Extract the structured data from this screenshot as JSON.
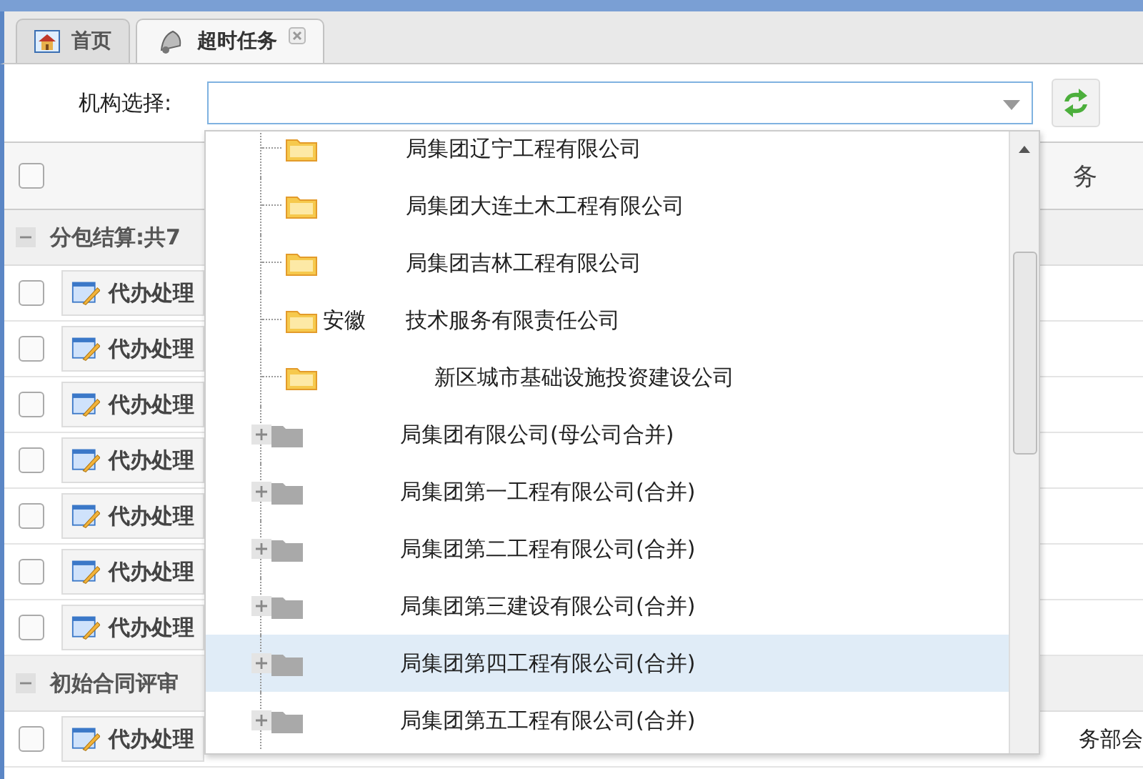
{
  "tabs": [
    {
      "label": "首页",
      "kind": "home",
      "selected": false,
      "closable": false
    },
    {
      "label": "超时任务",
      "kind": "alert",
      "selected": true,
      "closable": true
    }
  ],
  "filter": {
    "label": "机构选择:"
  },
  "grid": {
    "header_text": "务",
    "select_all_checked": false,
    "groups": [
      {
        "title": "分包结算:共7",
        "expanded": true,
        "rows": [
          {
            "action": "代办处理",
            "checked": false
          },
          {
            "action": "代办处理",
            "checked": false
          },
          {
            "action": "代办处理",
            "checked": false
          },
          {
            "action": "代办处理",
            "checked": false
          },
          {
            "action": "代办处理",
            "checked": false
          },
          {
            "action": "代办处理",
            "checked": false
          },
          {
            "action": "代办处理",
            "checked": false
          }
        ]
      },
      {
        "title": "初始合同评审",
        "expanded": true,
        "rows": [
          {
            "action": "代办处理",
            "checked": false,
            "extra": "务部会"
          }
        ]
      }
    ]
  },
  "dropdown": {
    "items": [
      {
        "kind": "leaf",
        "text": "局集团辽宁工程有限公司",
        "selected": false
      },
      {
        "kind": "leaf",
        "text": "局集团大连土木工程有限公司",
        "selected": false
      },
      {
        "kind": "leaf",
        "text": "局集团吉林工程有限公司",
        "selected": false
      },
      {
        "kind": "leaf",
        "prefix": "安徽",
        "text": "技术服务有限责任公司",
        "selected": false
      },
      {
        "kind": "leaf",
        "text": "新区城市基础设施投资建设公司",
        "selected": false
      },
      {
        "kind": "collapsed",
        "text": "局集团有限公司(母公司合并)",
        "selected": false
      },
      {
        "kind": "collapsed",
        "text": "局集团第一工程有限公司(合并)",
        "selected": false
      },
      {
        "kind": "collapsed",
        "text": "局集团第二工程有限公司(合并)",
        "selected": false
      },
      {
        "kind": "collapsed",
        "text": "局集团第三建设有限公司(合并)",
        "selected": false
      },
      {
        "kind": "collapsed",
        "text": "局集团第四工程有限公司(合并)",
        "selected": true
      },
      {
        "kind": "collapsed",
        "text": "局集团第五工程有限公司(合并)",
        "selected": false
      }
    ]
  }
}
